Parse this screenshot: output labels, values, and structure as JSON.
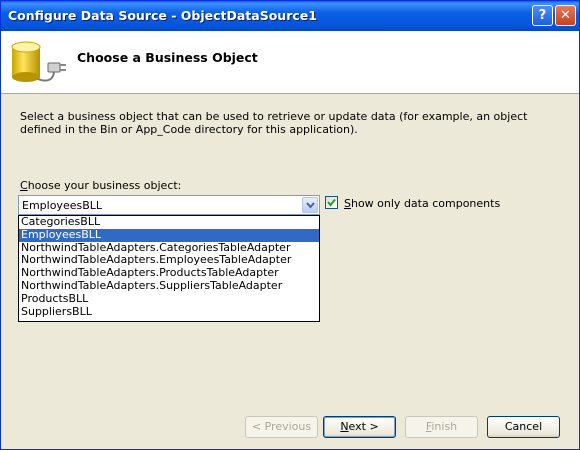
{
  "window": {
    "title": "Configure Data Source - ObjectDataSource1",
    "help_glyph": "?",
    "close_glyph": "✕"
  },
  "header": {
    "title": "Choose a Business Object"
  },
  "description": "Select a business object that can be used to retrieve or update data (for example, an object defined in the Bin or App_Code directory for this application).",
  "business_object": {
    "label_accel": "C",
    "label_rest": "hoose your business object:",
    "selected": "EmployeesBLL",
    "options": [
      "CategoriesBLL",
      "EmployeesBLL",
      "NorthwindTableAdapters.CategoriesTableAdapter",
      "NorthwindTableAdapters.EmployeesTableAdapter",
      "NorthwindTableAdapters.ProductsTableAdapter",
      "NorthwindTableAdapters.SuppliersTableAdapter",
      "ProductsBLL",
      "SuppliersBLL"
    ],
    "highlighted_index": 1
  },
  "show_only": {
    "checked": true,
    "label_accel": "S",
    "label_rest": "how only data components"
  },
  "buttons": {
    "previous": "< Previous",
    "next_accel": "N",
    "next_rest": "ext >",
    "finish_accel": "F",
    "finish_rest": "inish",
    "cancel": "Cancel"
  }
}
